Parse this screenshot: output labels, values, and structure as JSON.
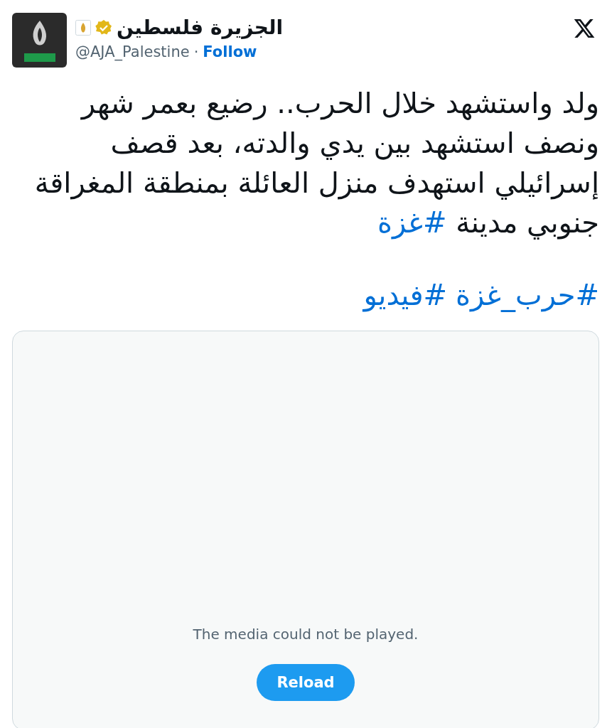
{
  "author": {
    "name": "الجزيرة فلسطين",
    "verified": true,
    "handle": "@AJA_Palestine",
    "separator": "·",
    "follow": "Follow"
  },
  "text": {
    "body": "ولد واستشهد خلال الحرب.. رضيع بعمر شهر ونصف استشهد بين يدي والدته، بعد قصف إسرائيلي استهدف منزل العائلة بمنطقة المغراقة جنوبي مدينة ",
    "hashtag": "#غزة"
  },
  "hashtags": [
    "#حرب_غزة",
    "#فيديو"
  ],
  "media": {
    "message": "The media could not be played.",
    "button": "Reload"
  }
}
